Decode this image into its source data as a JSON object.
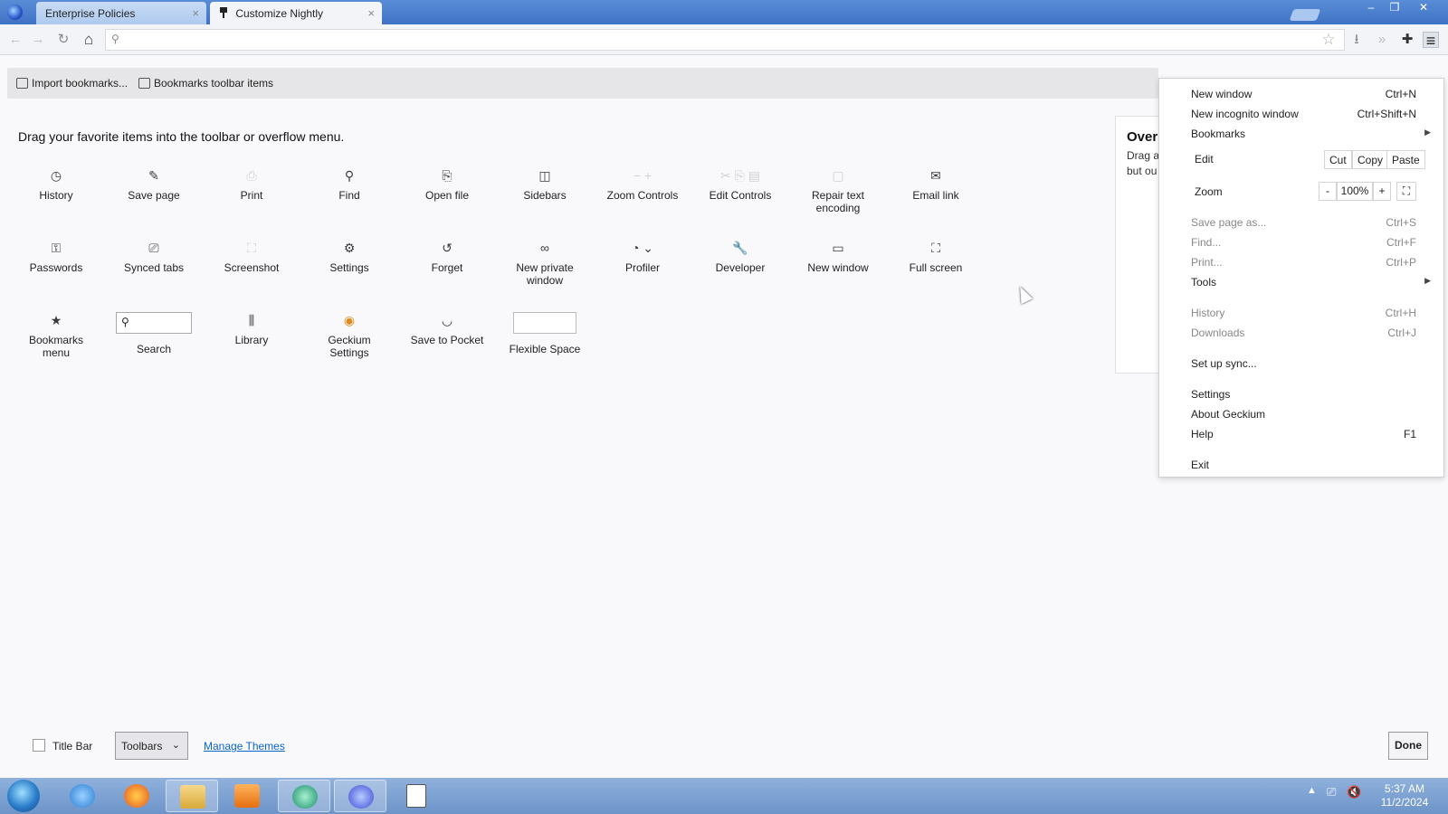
{
  "tabs": [
    {
      "title": "Enterprise Policies",
      "close": "×"
    },
    {
      "title": "Customize Nightly",
      "close": "×"
    }
  ],
  "window_controls": {
    "minimize": "–",
    "restore": "❐",
    "close": "✕"
  },
  "navbar": {
    "back": "←",
    "forward": "→",
    "reload": "↻",
    "home": "⌂",
    "search_glyph": "⚲",
    "url_value": "",
    "bookmark_star": "☆",
    "download": "⭳",
    "overflow": "»",
    "extensions": "✚",
    "menu": "≡"
  },
  "bookmarks_bar": {
    "import": "Import bookmarks...",
    "toolbar_items": "Bookmarks toolbar items"
  },
  "customize": {
    "instruction": "Drag your favorite items into the toolbar or overflow menu.",
    "items": [
      {
        "label": "History",
        "icon": "◷"
      },
      {
        "label": "Save page",
        "icon": "✎"
      },
      {
        "label": "Print",
        "icon": "⎙"
      },
      {
        "label": "Find",
        "icon": "⚲"
      },
      {
        "label": "Open file",
        "icon": "⎘"
      },
      {
        "label": "Sidebars",
        "icon": "◫"
      },
      {
        "label": "Zoom Controls",
        "icon": "− +"
      },
      {
        "label": "Edit Controls",
        "icon": "✂ ⎘ ▤"
      },
      {
        "label": "Repair text encoding",
        "icon": "▢"
      },
      {
        "label": "Email link",
        "icon": "✉"
      },
      {
        "label": "Passwords",
        "icon": "⚿"
      },
      {
        "label": "Synced tabs",
        "icon": "⎚"
      },
      {
        "label": "Screenshot",
        "icon": "⛶"
      },
      {
        "label": "Settings",
        "icon": "⚙"
      },
      {
        "label": "Forget",
        "icon": "↺"
      },
      {
        "label": "New private window",
        "icon": "∞"
      },
      {
        "label": "Profiler",
        "icon": "◔ ⌄"
      },
      {
        "label": "Developer",
        "icon": "🔧"
      },
      {
        "label": "New window",
        "icon": "▭"
      },
      {
        "label": "Full screen",
        "icon": "⛶"
      },
      {
        "label": "Bookmarks menu",
        "icon": "★"
      },
      {
        "label": "Search",
        "icon": "⚲"
      },
      {
        "label": "Library",
        "icon": "⫼"
      },
      {
        "label": "Geckium Settings",
        "icon": "◉"
      },
      {
        "label": "Save to Pocket",
        "icon": "◡"
      },
      {
        "label": "Flexible Space",
        "icon": ""
      }
    ]
  },
  "overflow_panel": {
    "title": "Over",
    "desc_line1": "Drag a",
    "desc_line2": "but ou"
  },
  "app_menu": {
    "new_window": {
      "label": "New window",
      "shortcut": "Ctrl+N"
    },
    "new_incognito": {
      "label": "New incognito window",
      "shortcut": "Ctrl+Shift+N"
    },
    "bookmarks": {
      "label": "Bookmarks"
    },
    "edit": {
      "label": "Edit",
      "cut": "Cut",
      "copy": "Copy",
      "paste": "Paste"
    },
    "zoom": {
      "label": "Zoom",
      "minus": "-",
      "value": "100%",
      "plus": "+",
      "fullscreen": "⛶"
    },
    "save_page": {
      "label": "Save page as...",
      "shortcut": "Ctrl+S"
    },
    "find": {
      "label": "Find...",
      "shortcut": "Ctrl+F"
    },
    "print": {
      "label": "Print...",
      "shortcut": "Ctrl+P"
    },
    "tools": {
      "label": "Tools"
    },
    "history": {
      "label": "History",
      "shortcut": "Ctrl+H"
    },
    "downloads": {
      "label": "Downloads",
      "shortcut": "Ctrl+J"
    },
    "sync": {
      "label": "Set up sync..."
    },
    "settings": {
      "label": "Settings"
    },
    "about": {
      "label": "About Geckium"
    },
    "help": {
      "label": "Help",
      "shortcut": "F1"
    },
    "exit": {
      "label": "Exit"
    },
    "submenu_arrow": "▶"
  },
  "bottom": {
    "title_bar": "Title Bar",
    "toolbars": "Toolbars",
    "toolbars_chev": "⌄",
    "manage_themes": "Manage Themes",
    "done": "Done"
  },
  "taskbar": {
    "time": "5:37 AM",
    "date": "11/2/2024",
    "tray_up": "▲",
    "tray_net": "⎚",
    "tray_vol": "🔇"
  },
  "colors": {
    "titlebar": "#4f83cf",
    "link": "#0a63c9",
    "taskbar": "#7fa3d4"
  }
}
